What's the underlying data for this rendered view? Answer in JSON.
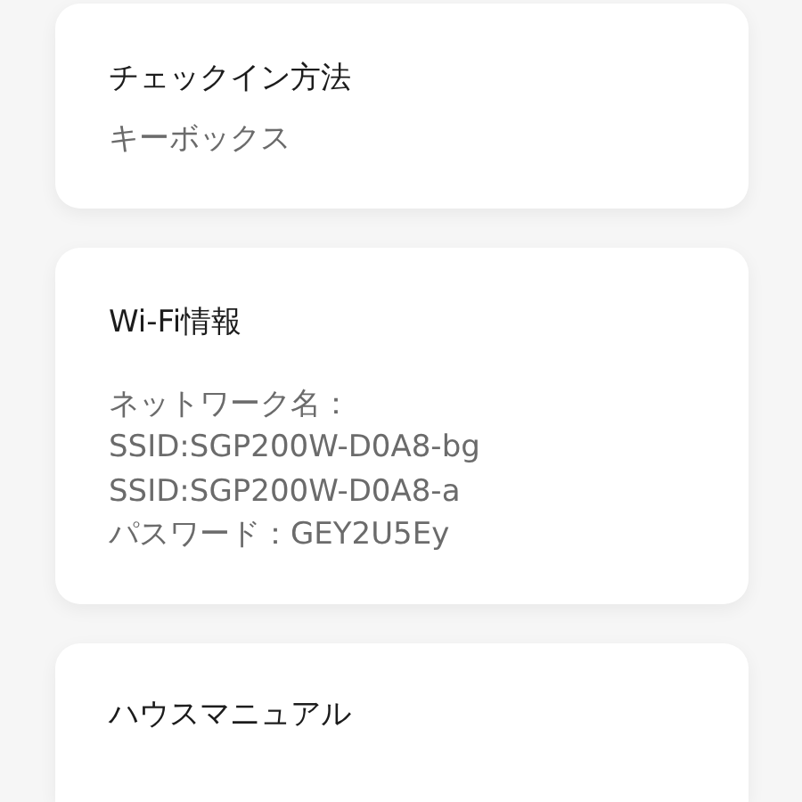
{
  "cards": [
    {
      "title": "チェックイン方法",
      "lines": [
        "キーボックス"
      ]
    },
    {
      "title": "Wi-Fi情報",
      "lines": [
        "ネットワーク名：",
        "SSID:SGP200W-D0A8-bg",
        "SSID:SGP200W-D0A8-a",
        "パスワード：GEY2U5Ey"
      ]
    },
    {
      "title": "ハウスマニュアル"
    }
  ]
}
